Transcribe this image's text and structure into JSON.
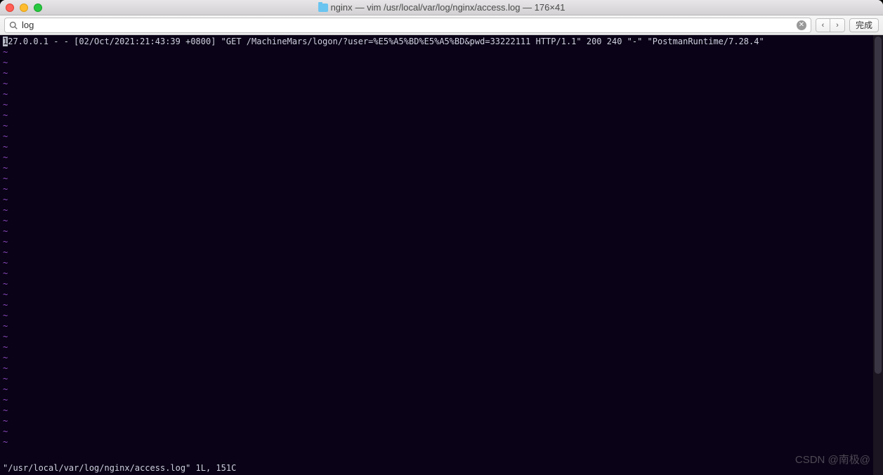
{
  "titlebar": {
    "folder_name": "nginx",
    "title_rest": " — vim /usr/local/var/log/nginx/access.log — 176×41"
  },
  "search": {
    "value": "log"
  },
  "nav": {
    "prev": "‹",
    "next": "›",
    "done": "完成"
  },
  "terminal": {
    "log_line_prefix": "1",
    "log_line": "27.0.0.1 - - [02/Oct/2021:21:43:39 +0800] \"GET /MachineMars/logon/?user=%E5%A5%BD%E5%A5%BD&pwd=33222111 HTTP/1.1\" 200 240 \"-\" \"PostmanRuntime/7.28.4\"",
    "tilde": "~",
    "tilde_count": 38,
    "status_line": "\"/usr/local/var/log/nginx/access.log\" 1L, 151C"
  },
  "watermark": "CSDN @南极@"
}
